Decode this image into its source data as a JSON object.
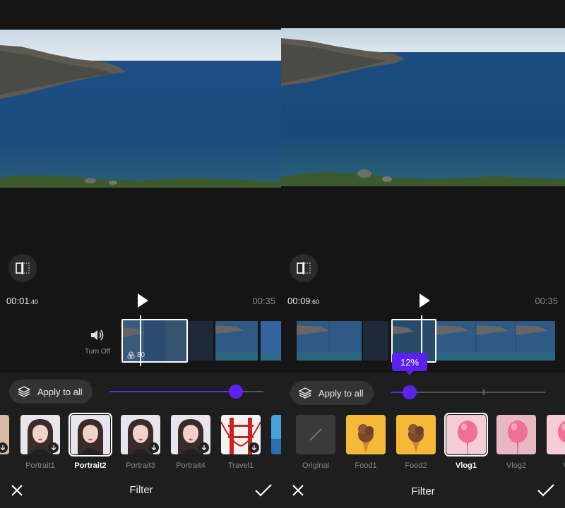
{
  "left": {
    "current_time": "00:01",
    "current_frac": ":40",
    "total_time": "00:35",
    "mute_label": "Turn Off",
    "clip_filter_strength": "80",
    "apply_label": "Apply to all",
    "slider_level": 0.82,
    "filters": [
      {
        "label": "Portrait1",
        "type": "portrait"
      },
      {
        "label": "Portrait2",
        "type": "portrait",
        "selected": true
      },
      {
        "label": "Portrait3",
        "type": "portrait"
      },
      {
        "label": "Portrait4",
        "type": "portrait"
      },
      {
        "label": "Travel1",
        "type": "bridge"
      },
      {
        "label": "T",
        "type": "sky"
      }
    ],
    "title": "Filter"
  },
  "right": {
    "current_time": "00:09",
    "current_frac": ":60",
    "total_time": "00:35",
    "apply_label": "Apply to all",
    "slider_percent": "12%",
    "slider_level": 0.12,
    "filters": [
      {
        "label": "Original",
        "type": "original"
      },
      {
        "label": "Food1",
        "type": "food"
      },
      {
        "label": "Food2",
        "type": "food"
      },
      {
        "label": "Vlog1",
        "type": "vlog",
        "selected": true
      },
      {
        "label": "Vlog2",
        "type": "vlog2"
      },
      {
        "label": "Vl",
        "type": "vlog"
      }
    ],
    "title": "Filter"
  },
  "colors": {
    "accent": "#5b21f0",
    "background": "#151515",
    "panel": "#1e1e1e"
  },
  "icons": [
    "split-compare-icon",
    "play-icon",
    "speaker-icon",
    "layers-icon",
    "close-icon",
    "check-icon",
    "download-icon",
    "filter-circles-icon"
  ]
}
